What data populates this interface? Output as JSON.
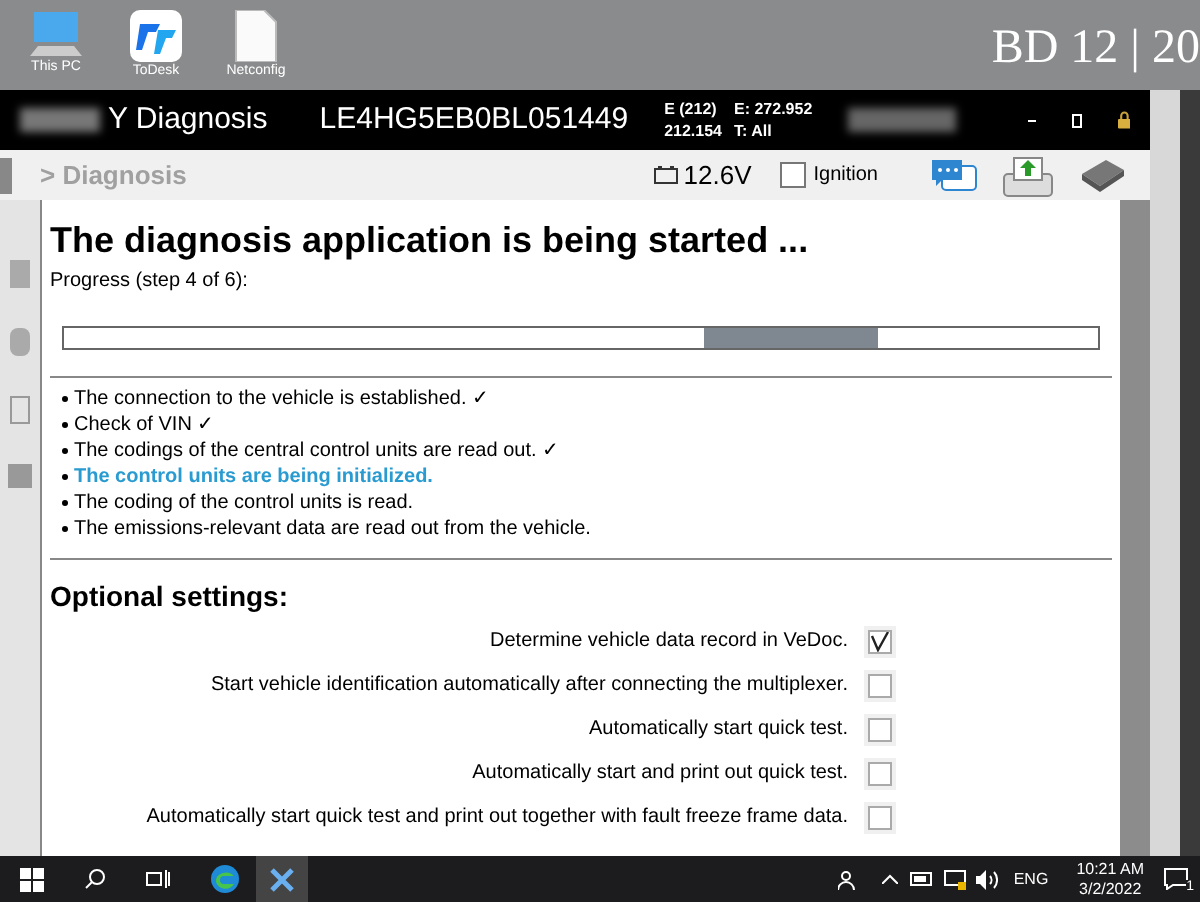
{
  "desktop": {
    "icons": [
      {
        "label": "This PC",
        "kind": "pc"
      },
      {
        "label": "ToDesk",
        "kind": "todesk"
      },
      {
        "label": "Netconfig",
        "kind": "file"
      }
    ],
    "banner": "BD 12 | 20"
  },
  "window": {
    "title": "Y Diagnosis",
    "vin": "LE4HG5EB0BL051449",
    "info": [
      "E (212)",
      "E: 272.952",
      "212.154",
      "T: All"
    ]
  },
  "toolbar": {
    "breadcrumb": "> Diagnosis",
    "voltage": "12.6V",
    "ignition": {
      "label": "Ignition",
      "checked": false
    }
  },
  "content": {
    "heading": "The diagnosis application is being started ...",
    "progress_label": "Progress (step 4 of 6):",
    "steps": [
      {
        "text": "The connection to the vehicle is established. ✓",
        "active": false
      },
      {
        "text": "Check of VIN ✓",
        "active": false
      },
      {
        "text": "The codings of the central control units are read out. ✓",
        "active": false
      },
      {
        "text": "The control units are being initialized.",
        "active": true
      },
      {
        "text": "The coding of the control units is read.",
        "active": false
      },
      {
        "text": "The emissions-relevant data are read out from the vehicle.",
        "active": false
      }
    ],
    "options_heading": "Optional settings:",
    "options": [
      {
        "label": "Determine vehicle data record in VeDoc.",
        "checked": true
      },
      {
        "label": "Start vehicle identification automatically after connecting the multiplexer.",
        "checked": false
      },
      {
        "label": "Automatically start quick test.",
        "checked": false
      },
      {
        "label": "Automatically start and print out quick test.",
        "checked": false
      },
      {
        "label": "Automatically start quick test and print out together with fault freeze frame data.",
        "checked": false
      }
    ]
  },
  "taskbar": {
    "language": "ENG",
    "time": "10:21 AM",
    "date": "3/2/2022",
    "notifications": "1"
  }
}
